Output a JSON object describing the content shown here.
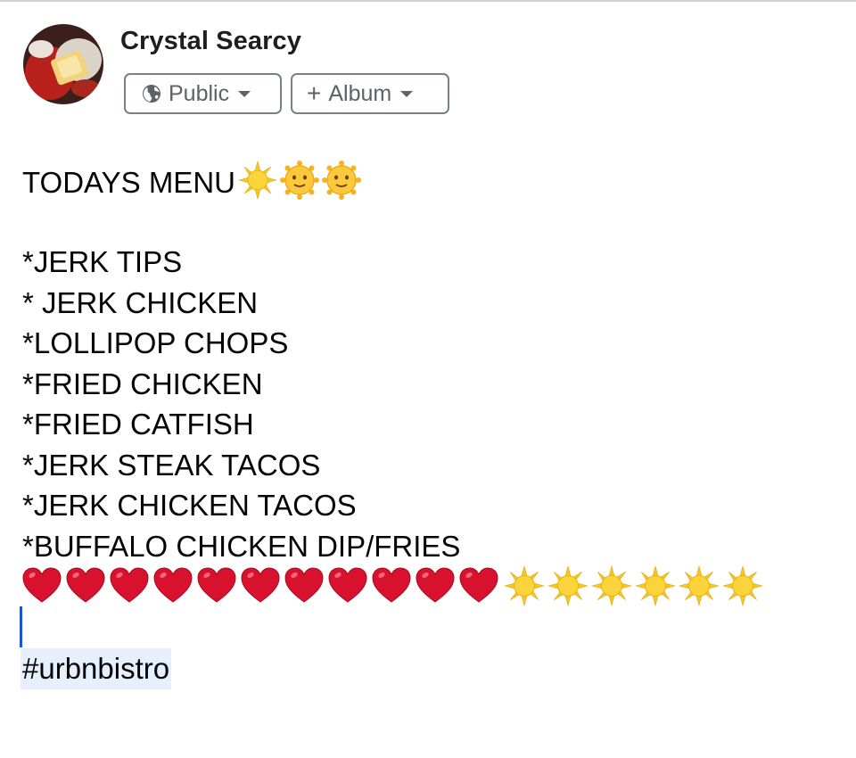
{
  "post": {
    "author": "Crystal Searcy",
    "privacy_label": "Public",
    "album_label": "Album",
    "heading": "TODAYS MENU",
    "menu_items": [
      "*JERK TIPS",
      "* JERK CHICKEN",
      "*LOLLIPOP CHOPS",
      "*FRIED CHICKEN",
      "*FRIED CATFISH",
      "*JERK STEAK TACOS",
      "*JERK CHICKEN TACOS",
      "*BUFFALO CHICKEN DIP/FRIES"
    ],
    "hashtag": "#urbnbistro"
  },
  "icons": {
    "heading_emojis": [
      "sun-icon",
      "sun-with-face-icon",
      "sun-with-face-icon"
    ],
    "row_hearts": 11,
    "row_suns": 6,
    "heart_color": "#d8112e",
    "sun_color": "#f7c524",
    "caret_color": "#1a56db"
  }
}
